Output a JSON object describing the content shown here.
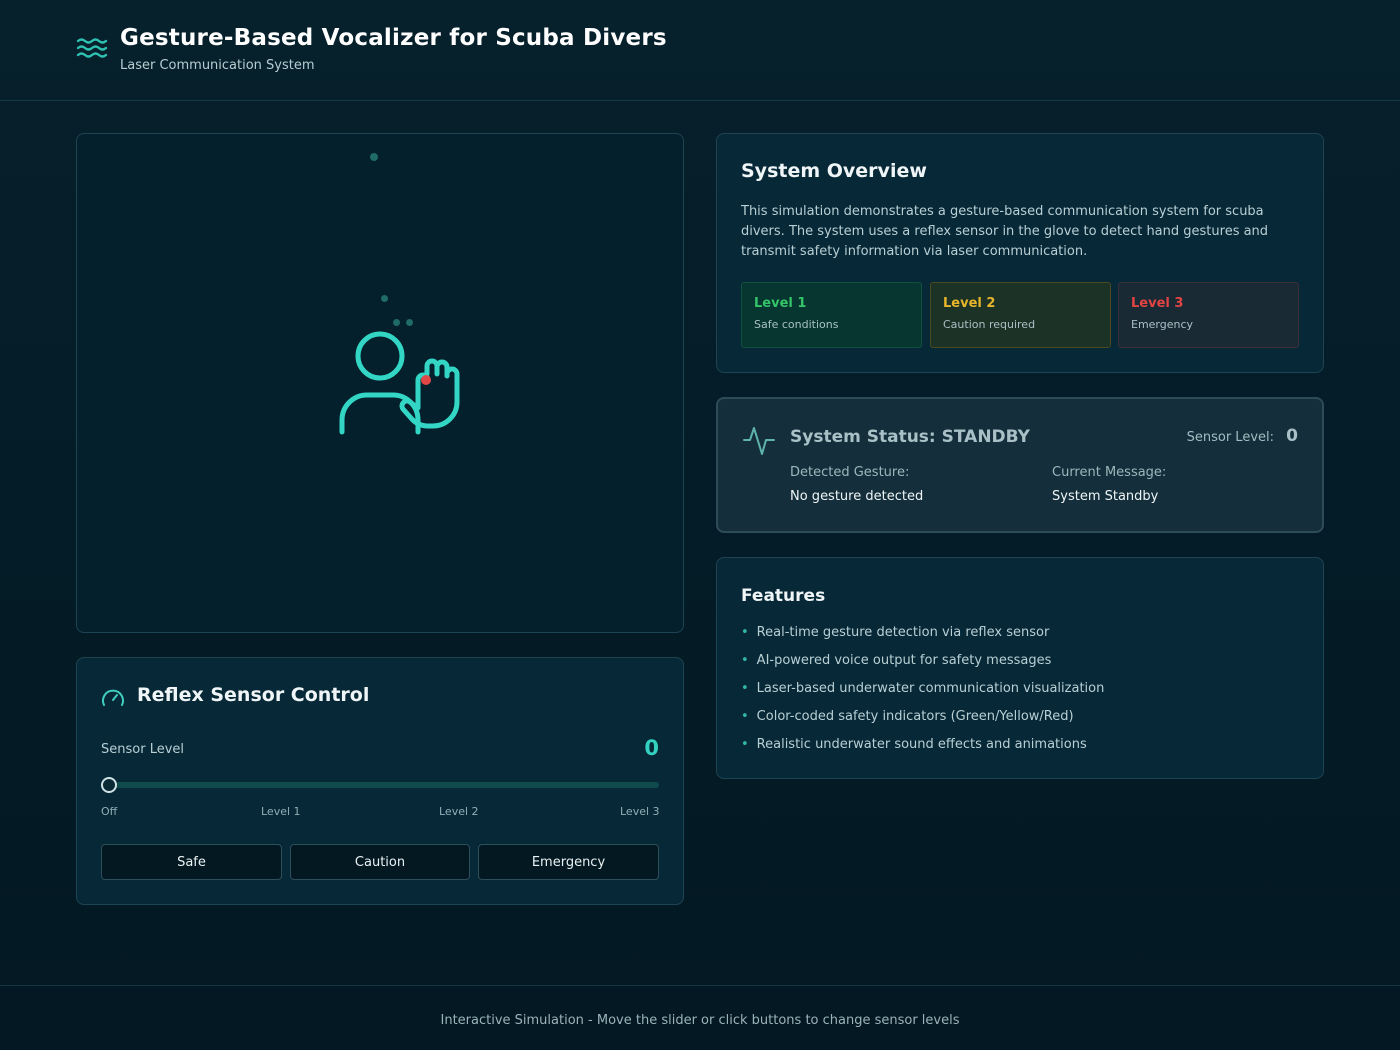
{
  "header": {
    "logo_icon": "waves-icon",
    "title": " Gesture-Based Vocalizer for Scuba Divers",
    "subtitle": "Laser Communication System"
  },
  "visualization": {
    "figure_icon": "diver-hand-gesture-icon",
    "indicator_color": "#e04848",
    "figure_color": "#33d6c4"
  },
  "control": {
    "icon": "gauge-icon",
    "title": "Reflex Sensor Control",
    "sensor_label": "Sensor Level",
    "sensor_value": "0",
    "slider": {
      "min": 0,
      "max": 3,
      "value": 0
    },
    "ticks": [
      "Off",
      "Level 1",
      "Level 2",
      "Level 3"
    ],
    "buttons": [
      "Safe",
      "Caution",
      "Emergency"
    ]
  },
  "overview": {
    "title": "System Overview",
    "description": "This simulation demonstrates a gesture-based communication system for scuba divers. The system uses a reflex sensor in the glove to detect hand gestures and transmit safety information via laser communication.",
    "levels": [
      {
        "name": "Level 1",
        "desc": "Safe conditions",
        "color": "#34c46a"
      },
      {
        "name": "Level 2",
        "desc": "Caution required",
        "color": "#e6b52a"
      },
      {
        "name": "Level 3",
        "desc": "Emergency",
        "color": "#e24444"
      }
    ]
  },
  "status": {
    "icon": "activity-pulse-icon",
    "title": "System Status: STANDBY",
    "sensor_level_label": "Sensor Level:",
    "sensor_level_value": "0",
    "gesture_label": "Detected Gesture:",
    "gesture_value": "No gesture detected",
    "message_label": "Current Message:",
    "message_value": "System Standby"
  },
  "features": {
    "title": "Features",
    "items": [
      "Real-time gesture detection via reflex sensor",
      "AI-powered voice output for safety messages",
      "Laser-based underwater communication visualization",
      "Color-coded safety indicators (Green/Yellow/Red)",
      "Realistic underwater sound effects and animations"
    ]
  },
  "footer": {
    "text": "Interactive Simulation - Move the slider or click buttons to change sensor levels"
  }
}
